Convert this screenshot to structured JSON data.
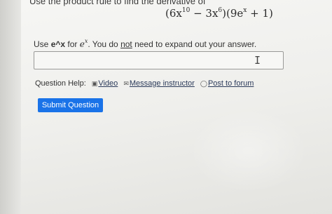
{
  "question": {
    "prompt": "Use the product rule to find the derivative of",
    "formula": {
      "part1": "(6x",
      "exp1": "10",
      "part2": " − 3x",
      "exp2": "6",
      "part3": ")(9e",
      "exp3": "x",
      "part4": " + 1)"
    }
  },
  "hint": {
    "use": "Use ",
    "code": "e^x",
    "for": " for ",
    "e_base": "e",
    "e_exp": "x",
    "rest1": ". You do ",
    "not": "not",
    "rest2": " need to expand out your answer."
  },
  "answer_input": {
    "value": ""
  },
  "help": {
    "label": "Question Help:",
    "video_label": "Video",
    "message_label": "Message instructor",
    "forum_label": "Post to forum",
    "icons": [
      "video-icon",
      "mail-icon",
      "forum-icon"
    ]
  },
  "submit_label": "Submit Question",
  "colors": {
    "submit_bg": "#1a73e8",
    "link": "#2b3a5a"
  }
}
